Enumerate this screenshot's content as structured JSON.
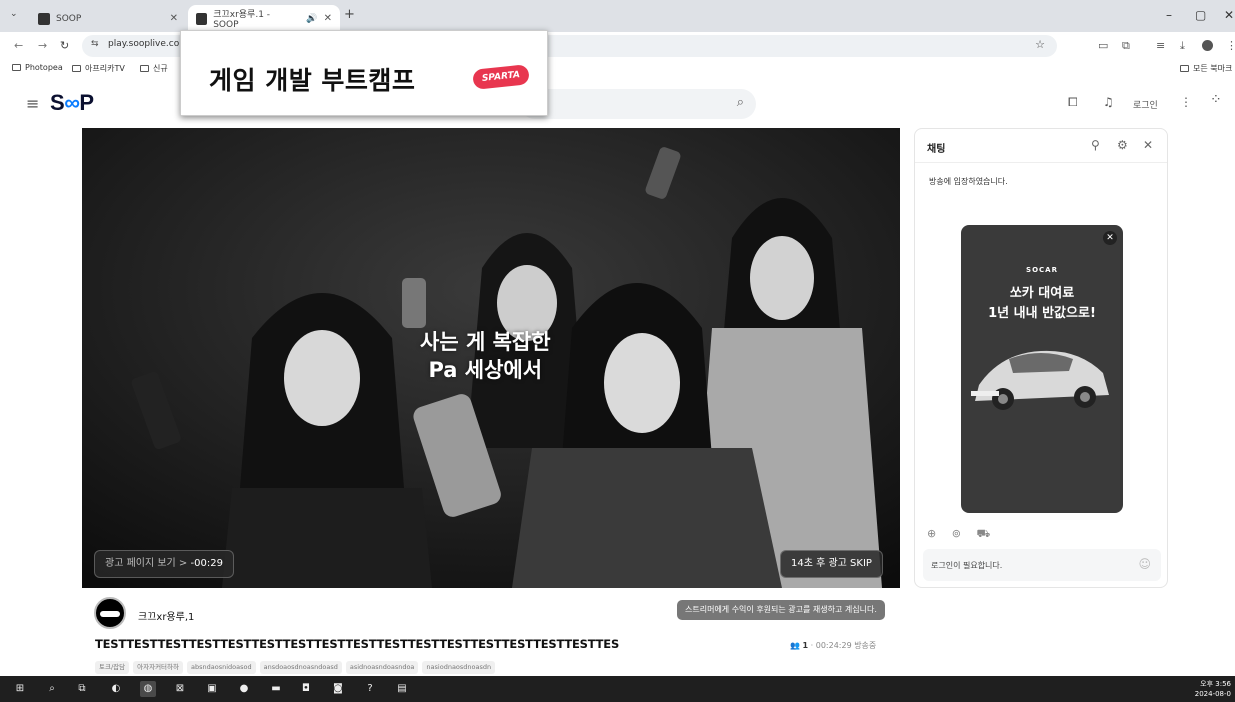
{
  "browser": {
    "tabs": [
      {
        "title": "SOOP",
        "active": false
      },
      {
        "title": "크끄xr용루.1 - SOOP",
        "active": true
      }
    ],
    "tab_list_icon": "chevron-down-icon",
    "new_tab": "+",
    "url": "play.sooplive.co.k",
    "bookmarks": [
      "Photopea",
      "아프리카TV",
      "신규"
    ],
    "all_bookmarks": "모든 북마크",
    "window_controls": [
      "–",
      "▢",
      "✕"
    ]
  },
  "site": {
    "logo_s": "S",
    "logo_oo": "∞",
    "logo_p": "P",
    "login": "로그인"
  },
  "ad_banner": {
    "title": "게임 개발 부트캠프",
    "badge": "SPARTA"
  },
  "player": {
    "ad_caption_line1": "사는 게 복잡한",
    "ad_caption_line2": "Pa 세상에서",
    "ad_page_label": "광고 페이지 보기 >",
    "ad_countdown": "-00:29",
    "skip_label": "14초 후 광고 SKIP"
  },
  "chat": {
    "title": "채팅",
    "system_message": "방송에 입장하였습니다.",
    "ad": {
      "brand": "SOCAR",
      "line1": "쏘카 대여료",
      "line2": "1년 내내 반값으로!"
    },
    "input_placeholder": "로그인이 필요합니다."
  },
  "stream": {
    "streamer_name": "크끄xr용루,1",
    "notice": "스트리머에게 수익이 후원되는 광고를 재생하고 계십니다.",
    "title": "TESTTESTTESTTESTTESTTESTTESTTESTTESTTESTTESTTESTTESTTESTTESTTESTTES",
    "viewers": "1",
    "elapsed": "· 00:24:29 방송중",
    "tags": [
      "토크/잡담",
      "아자자커터하하",
      "absndaosnidoasod",
      "ansdoaosdnoasndoasd",
      "asidnoasndoasndoa",
      "nasiodnaosdnoasdn"
    ]
  },
  "taskbar": {
    "time": "오후 3:56",
    "date": "2024-08-0"
  },
  "colors": {
    "accent": "#0a7cff",
    "badge": "#e8364f",
    "taskbar": "#1f1f1f"
  }
}
